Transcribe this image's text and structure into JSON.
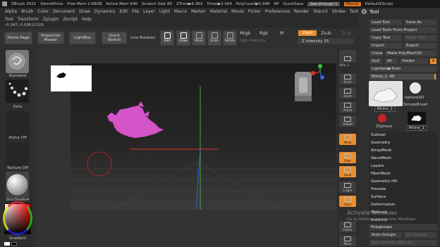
{
  "titlebar": {
    "app": "ZBrush 2021",
    "project": "DemoRhino",
    "free_mem": "Free Mem 2.69GB",
    "active_mem": "Active Mem 646",
    "scratch_disk": "Scratch Disk 80",
    "ztime": "ZTime▶6.363",
    "timer": "Timer▶0.004",
    "polycount": "PolyCount▶5.948",
    "units": "KP",
    "quicksave": "QuickSave",
    "see_through": "See-through  0",
    "menus": "Menus",
    "script": "DefaultZScript"
  },
  "menubar": {
    "row1": [
      "Alpha",
      "Brush",
      "Color",
      "Document",
      "Draw",
      "Dynamics",
      "Edit",
      "File",
      "Layer",
      "Light",
      "Macro",
      "Marker",
      "Material",
      "Movie",
      "Picker",
      "Preferences",
      "Render",
      "Stencil",
      "Stroke",
      "Texture"
    ],
    "row2": [
      "Tool",
      "Transform",
      "Zplugin",
      "Zscript",
      "Help"
    ]
  },
  "coords": "-0.347,-0.036,0.029",
  "shelf": {
    "home": "Home Page",
    "projection": "Projection Master",
    "lightbox": "LightBox",
    "quicksketch": "Quick Sketch",
    "liveboolean": "Live Boolean",
    "edit": "Edit",
    "draw": "Draw",
    "move": "Move",
    "scale": "Scale",
    "rotate": "Rotate",
    "mrgb": "Mrgb",
    "rgb": "Rgb",
    "m": "M",
    "rgb_intensity": "Rgb Intensity",
    "zadd": "Zadd",
    "zsub": "Zsub",
    "zcut": "Zcut",
    "z_intensity": "Z Intensity 25"
  },
  "leftpanel": {
    "brush": "Standard",
    "stroke": "Dots",
    "alpha": "Alpha Off",
    "texture": "Texture Off",
    "material": "SkinShade4",
    "gradient": "Gradient"
  },
  "rightstrip": {
    "spix": "SPix 3",
    "items": [
      "Scroll",
      "Zoom",
      "Actual",
      "AAHalf",
      "Persp",
      "Floor",
      "Local",
      "L.Sym",
      "Qxyz",
      "Frame",
      "Move"
    ]
  },
  "toolpanel": {
    "title": "Tool",
    "load_tool": "Load Tool",
    "save_as": "Save As",
    "load_from_project": "Load Tools From Project",
    "copy_tool": "Copy Tool",
    "paste_tool": "Paste Tool",
    "import": "Import",
    "export": "Export",
    "clone": "Clone",
    "make_polymesh": "Make PolyMesh3D",
    "goz": "GoZ",
    "all": "All",
    "visible": "Visible",
    "r": "R",
    "lightbox_tools": "Lightbox▶Tools",
    "current_tool": "Rhino_1. 48",
    "thumbs": [
      {
        "label": "Rhino_1"
      },
      {
        "label": "Sphere3D"
      },
      {
        "label": "SimpleBrush"
      },
      {
        "label": "ZSphere"
      },
      {
        "label": "Rhino_1"
      }
    ],
    "sections": [
      "Subtool",
      "Geometry",
      "ArrayMesh",
      "NanoMesh",
      "Layers",
      "FiberMesh",
      "Geometry HD",
      "Preview",
      "Surface",
      "Deformation",
      "Masking",
      "Visibility",
      "Polygroups"
    ],
    "auto_groups": "Auto Groups",
    "uv_groups": "Uv Groups",
    "auto_groups_uv": "Auto Groups With UV"
  },
  "watermark": {
    "line1": "Activate Windows",
    "line2": "Go to Settings to activate Windows."
  },
  "colors": {
    "accent": "#e98e2d",
    "model": "#d455c8",
    "axis_x": "#e0322a",
    "axis_y": "#3fbf3f",
    "axis_z": "#3a62d8"
  }
}
